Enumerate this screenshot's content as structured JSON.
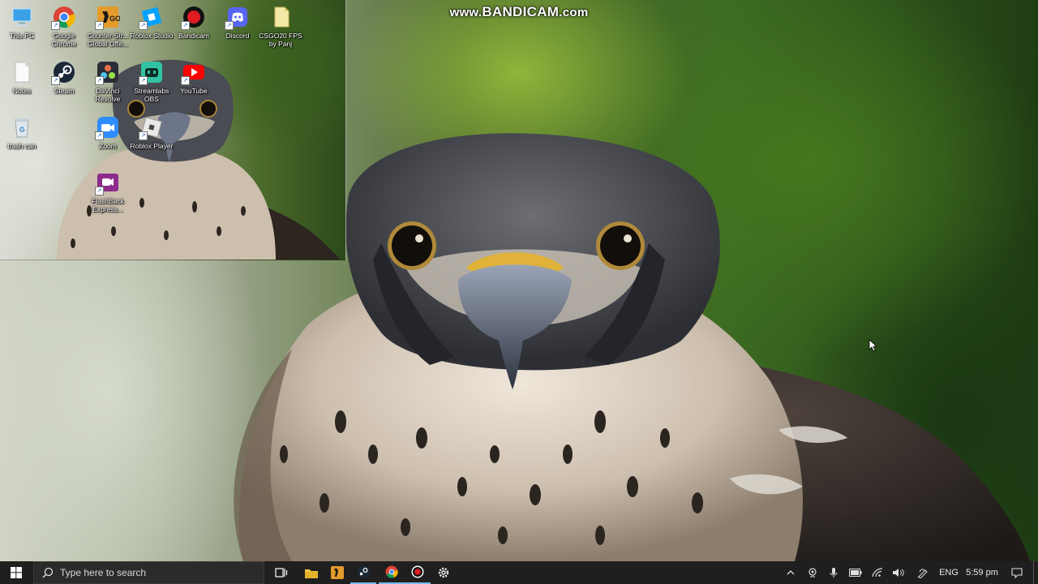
{
  "watermark": {
    "prefix": "www.",
    "brand": "BANDICAM",
    "suffix": ".com"
  },
  "desktop": {
    "icons": [
      {
        "id": "this-pc",
        "label": "This PC"
      },
      {
        "id": "google-chrome",
        "label": "Google\nChrome"
      },
      {
        "id": "csgo",
        "label": "Counter-Str...\nGlobal Offe..."
      },
      {
        "id": "roblox-studio",
        "label": "Roblox Studio"
      },
      {
        "id": "bandicam",
        "label": "Bandicam"
      },
      {
        "id": "discord",
        "label": "Discord"
      },
      {
        "id": "csgo20-fps",
        "label": "CSGO20 FPS\nby Panj"
      },
      {
        "id": "notes",
        "label": "Notes"
      },
      {
        "id": "steam",
        "label": "Steam"
      },
      {
        "id": "davinci",
        "label": "DaVinci\nResolve"
      },
      {
        "id": "streamlabs",
        "label": "Streamlabs\nOBS"
      },
      {
        "id": "youtube",
        "label": "YouTube"
      },
      {
        "id": "trash",
        "label": "trash can"
      },
      {
        "id": "zoom",
        "label": "Zoom"
      },
      {
        "id": "roblox-player",
        "label": "Roblox Player"
      },
      {
        "id": "flashback",
        "label": "FlashBack\nExpress..."
      }
    ]
  },
  "taskbar": {
    "search_placeholder": "Type here to search",
    "language": "ENG",
    "time": "5:59 pm"
  },
  "colors": {
    "taskbar_bg": "#1f1f1f",
    "chrome_red": "#db4437",
    "chrome_yellow": "#f4b400",
    "chrome_green": "#0f9d58",
    "chrome_blue": "#4285f4",
    "steam_blue": "#1b2838",
    "discord": "#5865f2",
    "youtube_red": "#ff0000",
    "bandicam_red": "#e01b24",
    "roblox_blue": "#00a2ff",
    "zoom_blue": "#2d8cff"
  }
}
